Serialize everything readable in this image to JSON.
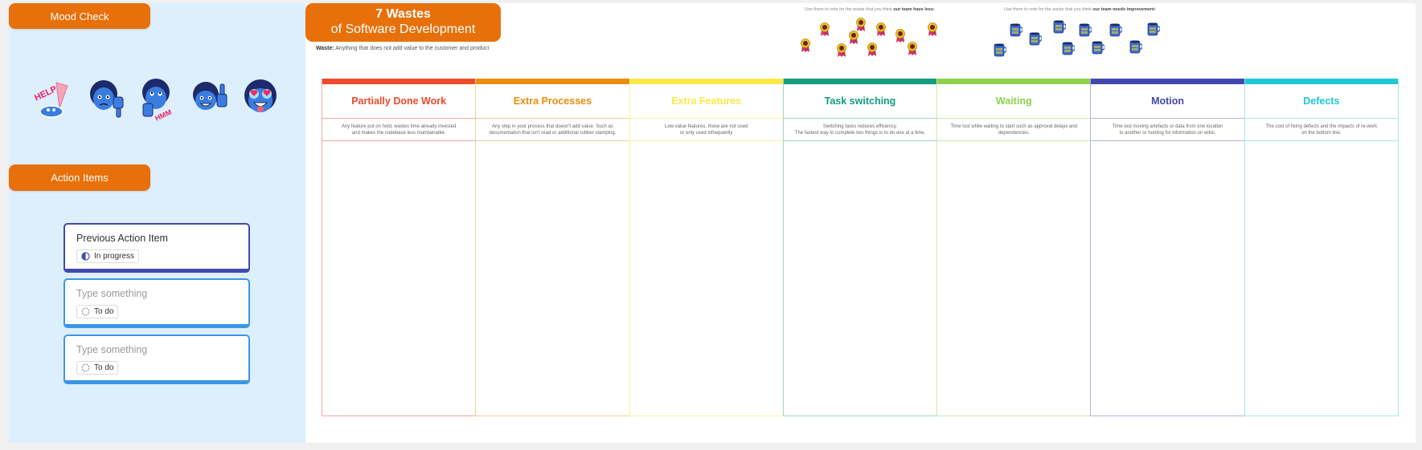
{
  "left_panel": {
    "mood_check_label": "Mood Check",
    "stickers": [
      {
        "name": "help-ice-cream-sticker",
        "text": "HELP"
      },
      {
        "name": "thumbs-down-sticker",
        "text": ""
      },
      {
        "name": "hmm-thinking-sticker",
        "text": "HMM"
      },
      {
        "name": "thumbs-up-sticker",
        "text": ""
      },
      {
        "name": "heart-eyes-sticker",
        "text": ""
      }
    ],
    "action_items_label": "Action Items",
    "cards": [
      {
        "title": "Previous Action Item",
        "status": "In progress"
      },
      {
        "title": "Type something",
        "status": "To do"
      },
      {
        "title": "Type something",
        "status": "To do"
      }
    ]
  },
  "header": {
    "title": "7 Wastes",
    "subtitle": "of Software Development",
    "waste_label": "Waste:",
    "waste_definition": "Anything that does not add value to the customer and product"
  },
  "voting": {
    "badges_note_prefix": "Use them to vote for the waste that you think ",
    "badges_note_bold": "our team have less:",
    "mugs_note_prefix": "Use them to vote for the waste that you think ",
    "mugs_note_bold": "our team needs improvement:",
    "badge_count": 10,
    "mug_count": 10
  },
  "colors": {
    "orange": "#e8700a",
    "panel_bg": "#ddeefc",
    "prev_card_border": "#4249ae",
    "todo_card_border": "#3a96e8"
  },
  "columns": [
    {
      "title": "Partially Done Work",
      "color": "#ee4b2b",
      "line": "#f3a9a0",
      "desc1": "Any feature put on hold, wastes time already invested",
      "desc2": "and makes the codebase less maintainable."
    },
    {
      "title": "Extra Processes",
      "color": "#ec8c0d",
      "line": "#f6cd97",
      "desc1": "Any step in your process that doesn't add value. Such as",
      "desc2": "documentation that isn't read or additional rubber stamping."
    },
    {
      "title": "Extra Features",
      "color": "#fbe94a",
      "line": "#fcf0a4",
      "desc1": "Low value features, those are not used",
      "desc2": "or only used infrequently"
    },
    {
      "title": "Task switching",
      "color": "#119d7e",
      "line": "#9fd8c5",
      "desc1": "Switching tasks reduces efficiency.",
      "desc2": "The fastest way to complete two things is to do one at a time."
    },
    {
      "title": "Waiting",
      "color": "#8fd14f",
      "line": "#cde9b0",
      "desc1": "Time lost while waiting to start such as approval delays and",
      "desc2": "dependencies."
    },
    {
      "title": "Motion",
      "color": "#4249ae",
      "line": "#b2b5dd",
      "desc1": "Time lost moving artefacts or data from one location",
      "desc2": "to another or hunting for information on wikis."
    },
    {
      "title": "Defects",
      "color": "#1ec8d6",
      "line": "#a6e7ed",
      "desc1": "The cost of fixing defects and the impacts of re-work",
      "desc2": "on the bottom line."
    }
  ]
}
